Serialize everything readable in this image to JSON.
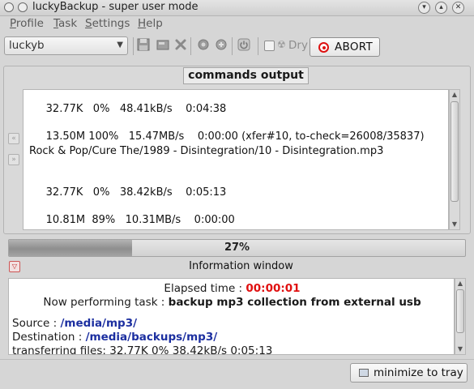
{
  "window": {
    "title": "luckyBackup - super user mode"
  },
  "menu": {
    "items": [
      {
        "underline": "P",
        "rest": "rofile"
      },
      {
        "underline": "T",
        "rest": "ask"
      },
      {
        "underline": "S",
        "rest": "ettings"
      },
      {
        "underline": "H",
        "rest": "elp"
      }
    ]
  },
  "toolbar": {
    "profile_value": "luckyb",
    "icons": [
      "save-icon",
      "save-as-icon",
      "delete-icon",
      "refresh-icon",
      "settings-icon",
      "shutdown-icon"
    ],
    "dry_label": "Dry",
    "dry_checked": false,
    "abort_label": "ABORT"
  },
  "commands": {
    "title": "commands output",
    "lines": [
      "     32.77K   0%   48.41kB/s    0:04:38",
      "     13.50M 100%   15.47MB/s    0:00:00 (xfer#10, to-check=26008/35837)",
      "Rock & Pop/Cure The/1989 - Disintegration/10 - Disintegration.mp3",
      "     32.77K   0%   38.42kB/s    0:05:13",
      "     10.81M  89%   10.31MB/s    0:00:00"
    ]
  },
  "progress": {
    "percent": 27,
    "label": "27%"
  },
  "info": {
    "title": "Information window",
    "elapsed_label": "Elapsed time : ",
    "elapsed_value": "00:00:01",
    "task_label": "Now performing task : ",
    "task_value": "backup mp3 collection from external usb",
    "source_label": "Source : ",
    "source_value": "/media/mp3/",
    "dest_label": "Destination : ",
    "dest_value": "/media/backups/mp3/",
    "transfer_text": "transferring files: 32.77K 0% 38.42kB/s 0:05:13"
  },
  "bottom": {
    "minimize_label": "minimize to tray"
  },
  "colors": {
    "abort_red": "#dd1111",
    "elapsed_red": "#e01010",
    "path_blue": "#1c2fa0"
  }
}
